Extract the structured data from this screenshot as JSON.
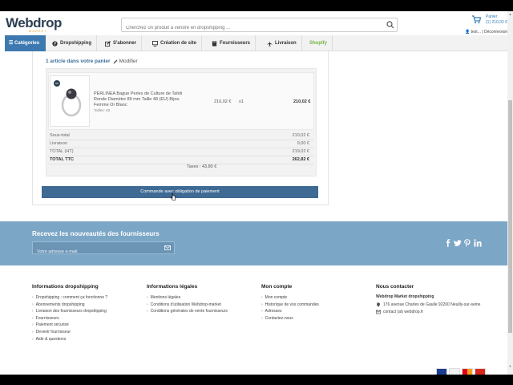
{
  "brand": {
    "name": "Webdrop",
    "tagline": "MARKET"
  },
  "header": {
    "search_placeholder": "Cherchez un produit à vendre en dropshipping ...",
    "cart_label": "Panier",
    "cart_total": "(1) 210,02 €",
    "user_name": "test...",
    "user_separator": "|",
    "logout_label": "Déconnexion"
  },
  "nav": {
    "categories": "Catégories",
    "items": [
      {
        "label": "Dropshipping",
        "icon": "question-icon"
      },
      {
        "label": "S'abonner",
        "icon": "edit-icon"
      },
      {
        "label": "Création de site",
        "icon": "monitor-icon"
      },
      {
        "label": "Fournisseurs",
        "icon": "book-icon"
      },
      {
        "label": "Livraison",
        "icon": "plane-icon"
      },
      {
        "label": "Shopify",
        "icon": ""
      }
    ]
  },
  "cart": {
    "title": "1 article dans votre panier",
    "modify_label": "Modifier",
    "product": {
      "name": "PERLINEA Bague Perles de Culture de Tahiti Ronde Diamètre 89 mm Taille 48 (EU) Bijou Femme Or Blanc",
      "attr": "Tailles: 48",
      "unit_price": "210,02 €",
      "qty": "x1",
      "total": "210,02 €"
    },
    "summary": [
      {
        "label": "Sous-total",
        "value": "210,02 €",
        "bold": false
      },
      {
        "label": "Livraison",
        "value": "9,00 €",
        "bold": false
      },
      {
        "label": "TOTAL (HT)",
        "value": "219,02 €",
        "bold": false
      },
      {
        "label": "TOTAL TTC",
        "value": "262,82 €",
        "bold": true
      }
    ],
    "taxes": "Taxes : 43,80 €",
    "order_button": "Commande avec obligation de paiement"
  },
  "newsletter": {
    "title": "Recevez les nouveautés des fournisseurs",
    "placeholder": "Votre adresse e-mail",
    "social": [
      "facebook-icon",
      "twitter-icon",
      "pinterest-icon",
      "linkedin-icon"
    ]
  },
  "footer": {
    "col1": {
      "title": "Informations dropshipping",
      "links": [
        "Dropshipping : comment ça fonctionne ?",
        "Abonnements dropshipping",
        "Livraison des fournisseurs dropshipping",
        "Fournisseurs",
        "Paiement sécurisé",
        "Devenir fournisseur",
        "Aide & questions"
      ]
    },
    "col2": {
      "title": "Informations légales",
      "links": [
        "Mentions légales",
        "Conditions d'utilisation Webdrop-market",
        "Conditions générales de vente fournisseurs"
      ]
    },
    "col3": {
      "title": "Mon compte",
      "links": [
        "Mon compte",
        "Historique de vos commandes",
        "Adresses",
        "Contactez-nous"
      ]
    },
    "col4": {
      "title": "Nous contacter",
      "company": "Webdrop Market dropshipping",
      "address": "176 avenue Charles de Gaulle 92200 Neuilly-sur-seine",
      "email": "contact (at) webdrop.fr"
    }
  },
  "colors": {
    "accent": "#3d79b0",
    "newsletter": "#7ca6c6",
    "order_button": "#3e6a94",
    "shopify": "#7ab241"
  }
}
